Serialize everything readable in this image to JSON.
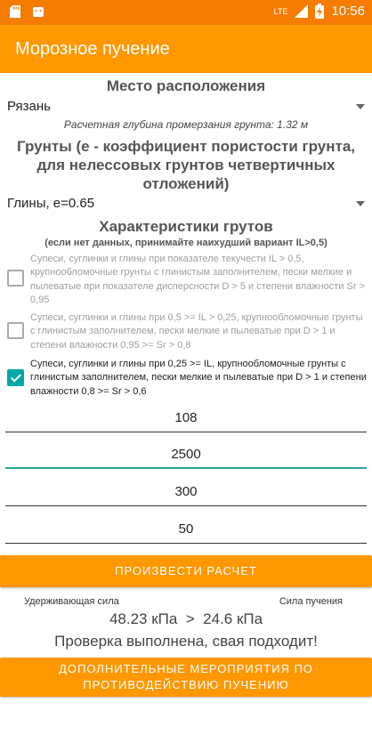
{
  "status_bar": {
    "network": "LTE",
    "time": "10:56"
  },
  "app_bar": {
    "title": "Морозное пучение"
  },
  "location": {
    "heading": "Место расположения",
    "selected": "Рязань",
    "depth_text": "Расчетная глубина промерзания грунта: 1.32 м"
  },
  "soils": {
    "heading": "Грунты (е - коэффициент пористости грунта, для нелессовых грунтов четвертичных отложений)",
    "selected": "Глины, е=0.65"
  },
  "characteristics": {
    "heading": "Характеристики грутов",
    "hint": "(если нет данных, принимайте наихудший вариант IL>0,5)",
    "options": [
      {
        "text": "Супеси, суглинки и глины при показателе текучести IL > 0,5, крупнообломочные грунты с глинистым заполнителем, пески мелкие и пылеватые при показателе дисперсности D > 5 и степени влажности Sr > 0,95",
        "checked": false
      },
      {
        "text": "Супеси, суглинки и глины при 0,5 >= IL > 0,25, крупнообломочные грунты с глинистым заполнителем, пески мелкие и пылеватые при D > 1 и степени влажности 0,95 >= Sr > 0,8",
        "checked": false
      },
      {
        "text": "Супеси, суглинки и глины при 0,25 >= IL, крупнообломочные грунты с глинистым заполнителем, пески мелкие и пылеватые при D > 1 и степени влажности 0,8 >= Sr > 0,6",
        "checked": true
      }
    ]
  },
  "inputs": {
    "field1": "108",
    "field2": "2500",
    "field3": "300",
    "field4": "50"
  },
  "buttons": {
    "calculate": "ПРОИЗВЕСТИ РАСЧЕТ",
    "measures": "ДОПОЛНИТЕЛЬНЫЕ МЕРОПРИЯТИЯ ПО ПРОТИВОДЕЙСТВИЮ ПУЧЕНИЮ"
  },
  "results": {
    "holding_label": "Удерживающая сила",
    "heave_label": "Сила пучения",
    "comparison": "48.23 кПа  >  24.6 кПа",
    "verdict": "Проверка выполнена, свая подходит!"
  },
  "colors": {
    "status_bar": "#f57c00",
    "app_bar": "#ff9800",
    "accent": "#00a9a6"
  }
}
